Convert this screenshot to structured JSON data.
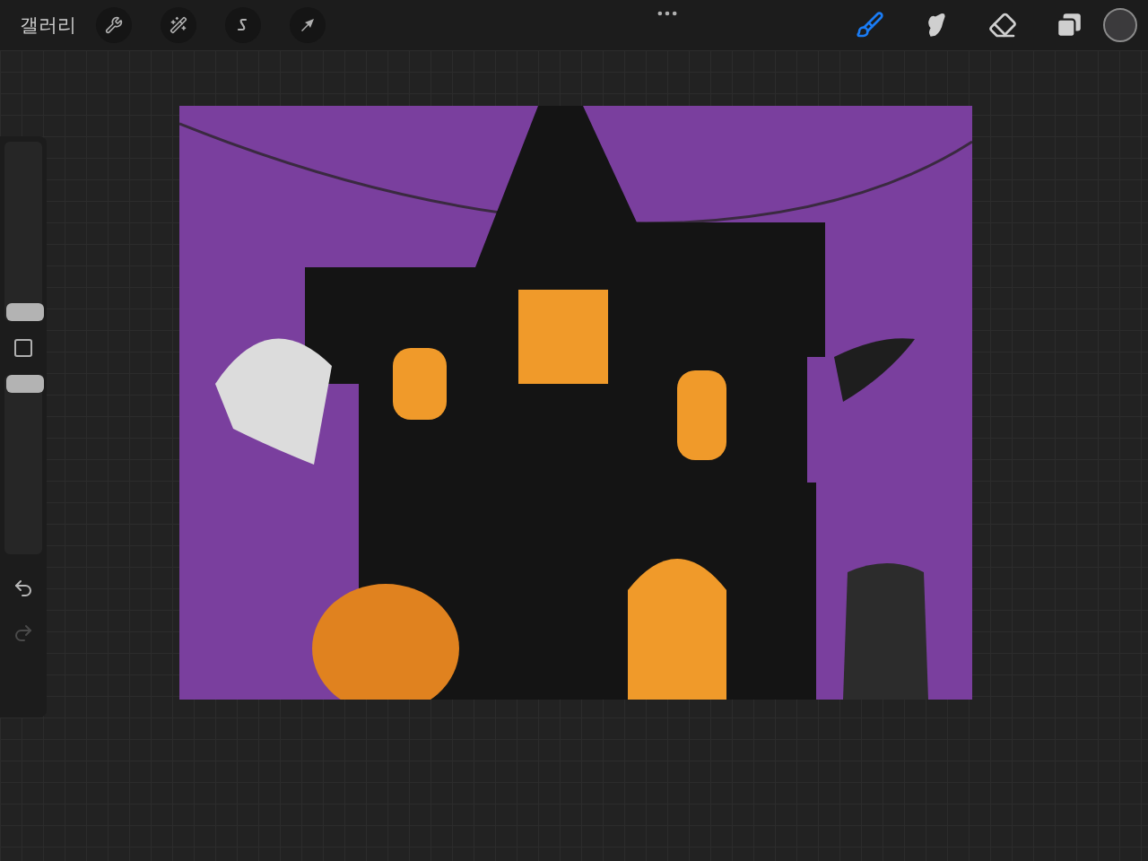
{
  "toolbar": {
    "gallery": "갤러리",
    "actions": [
      {
        "kind": "wrench"
      },
      {
        "kind": "wand"
      },
      {
        "kind": "selection"
      },
      {
        "kind": "transform"
      }
    ],
    "tools": [
      {
        "kind": "brush",
        "selected": true
      },
      {
        "kind": "smudge",
        "selected": false
      },
      {
        "kind": "eraser",
        "selected": false
      },
      {
        "kind": "layers",
        "selected": false
      }
    ],
    "color": "#3b3a3c"
  },
  "sidebar": {
    "brush_size": {
      "level": 0
    },
    "opacity": {
      "level": 1
    },
    "undo": {
      "disabled": false
    },
    "redo": {
      "disabled": true
    }
  }
}
